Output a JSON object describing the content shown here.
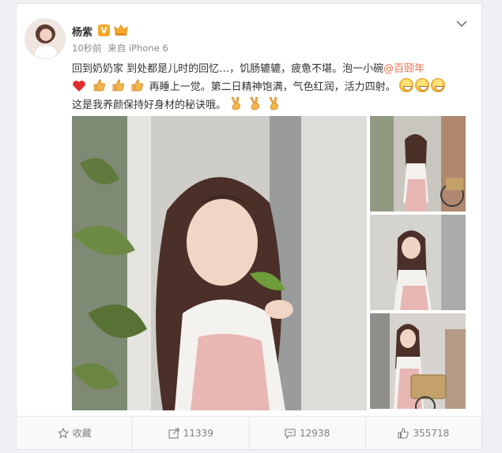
{
  "user": {
    "name": "杨紫",
    "verified_mark": "V"
  },
  "post": {
    "time": "10秒前",
    "source": "来自 iPhone 6",
    "text_line1": "回到奶奶家 到处都是儿时的回忆…，饥肠辘辘，疲惫不堪。泡一小碗",
    "mention": "@百颐年",
    "text_line2": "再睡上一觉。第二日精神饱满，气色红润，活力四射。",
    "text_line3": "这是我养颜保持好身材的秘诀哦。"
  },
  "actions": {
    "favorite": "收藏",
    "repost_count": "11339",
    "comment_count": "12938",
    "like_count": "355718"
  },
  "colors": {
    "link": "#eb7350",
    "verified_badge": "#f6a623",
    "footer_text": "#808080"
  },
  "icons": [
    "chevron-down-icon",
    "star-icon",
    "share-icon",
    "comment-icon",
    "like-icon",
    "heart-emoji",
    "thumbs-up-emoji",
    "victory-emoji",
    "grin-emoji"
  ]
}
